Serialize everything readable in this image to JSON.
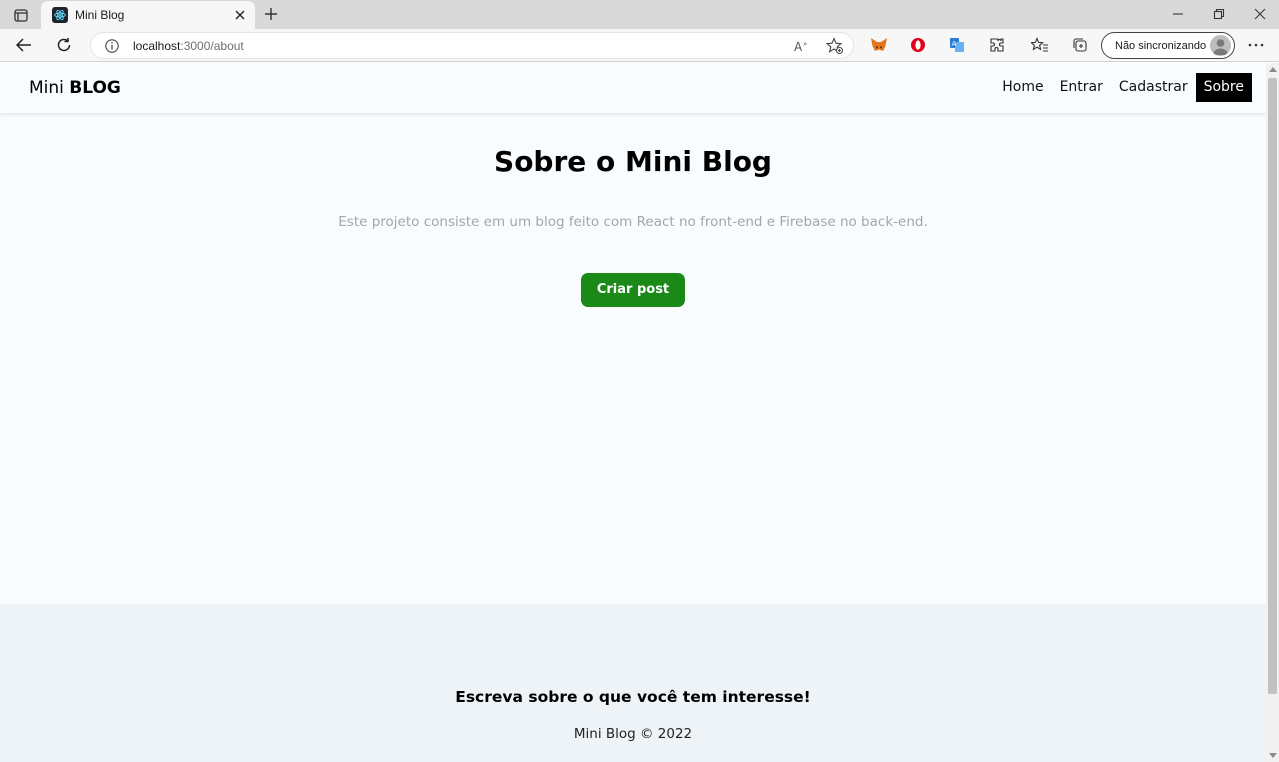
{
  "browser": {
    "tab": {
      "title": "Mini Blog"
    },
    "address": {
      "host": "localhost",
      "path": ":3000/about"
    },
    "sync_label": "Não sincronizando"
  },
  "page": {
    "brand": {
      "light": "Mini",
      "bold": "BLOG"
    },
    "nav": {
      "items": [
        {
          "label": "Home"
        },
        {
          "label": "Entrar"
        },
        {
          "label": "Cadastrar"
        },
        {
          "label": "Sobre",
          "active": true
        }
      ]
    },
    "about": {
      "title": "Sobre o Mini Blog",
      "description": "Este projeto consiste em um blog feito com React no front-end e Firebase no back-end.",
      "cta_label": "Criar post"
    },
    "footer": {
      "tagline": "Escreva sobre o que você tem interesse!",
      "copyright": "Mini Blog © 2022"
    }
  },
  "colors": {
    "accent": "#1a8918",
    "page_bg": "#f8fcff",
    "footer_bg": "#edf3f6",
    "active_nav_bg": "#000000"
  }
}
